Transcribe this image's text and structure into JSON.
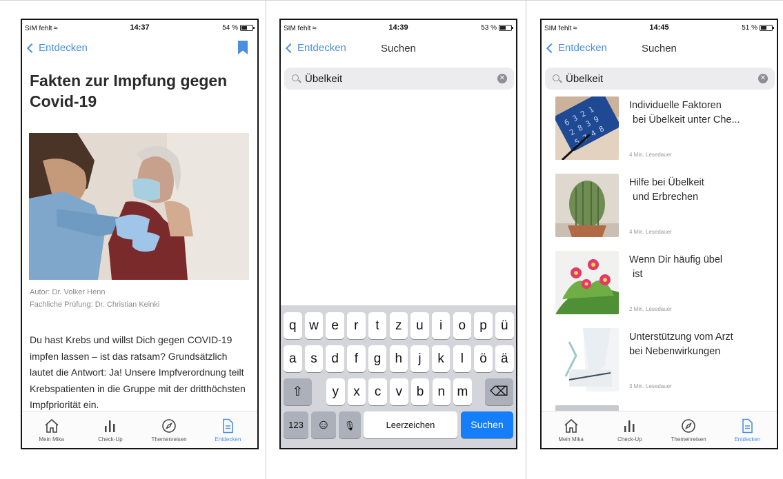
{
  "status_bars": [
    {
      "carrier": "SIM fehlt",
      "time": "14:37",
      "battery": "54 %",
      "battery_level": 0.54
    },
    {
      "carrier": "SIM fehlt",
      "time": "14:39",
      "battery": "53 %",
      "battery_level": 0.53
    },
    {
      "carrier": "SIM fehlt",
      "time": "14:45",
      "battery": "51 %",
      "battery_level": 0.51
    }
  ],
  "back_label": "Entdecken",
  "search_title": "Suchen",
  "search_value": "Übelkeit",
  "article": {
    "title": "Fakten zur Impfung gegen Covid-19",
    "author": "Autor: Dr. Volker Henn",
    "review": "Fachliche Prüfung: Dr. Christian Keinki",
    "body": "Du hast Krebs und willst Dich gegen COVID-19 impfen lassen – ist das ratsam? Grundsätzlich lautet die Antwort: Ja! Unsere Impfverordnung teilt Krebspatienten in die Gruppe mit der dritthöchsten Impfpriorität ein."
  },
  "tabs": [
    {
      "label": "Mein Mika",
      "icon": "home-icon"
    },
    {
      "label": "Check-Up",
      "icon": "bar-chart-icon"
    },
    {
      "label": "Themenreisen",
      "icon": "compass-icon"
    },
    {
      "label": "Entdecken",
      "icon": "document-icon"
    }
  ],
  "keyboard": {
    "row1": [
      "q",
      "w",
      "e",
      "r",
      "t",
      "z",
      "u",
      "i",
      "o",
      "p",
      "ü"
    ],
    "row2": [
      "a",
      "s",
      "d",
      "f",
      "g",
      "h",
      "j",
      "k",
      "l",
      "ö",
      "ä"
    ],
    "row3": [
      "y",
      "x",
      "c",
      "v",
      "b",
      "n",
      "m"
    ],
    "numbers": "123",
    "space": "Leerzeichen",
    "go": "Suchen"
  },
  "results": [
    {
      "line1": "Individuelle Faktoren",
      "line2": "bei Übelkeit unter Che...",
      "meta": "4 Min. Lesedauer"
    },
    {
      "line1": "Hilfe bei Übelkeit",
      "line2": "und Erbrechen",
      "meta": "4 Min. Lesedauer"
    },
    {
      "line1": "Wenn Dir häufig übel",
      "line2": "ist",
      "meta": "2 Min. Lesedauer"
    },
    {
      "line1": "Unterstützung vom Arzt",
      "line2": "bei Nebenwirkungen",
      "meta": "3 Min. Lesedauer"
    }
  ],
  "colors": {
    "accent": "#4a8fe0",
    "keyboard_go": "#157efb"
  }
}
